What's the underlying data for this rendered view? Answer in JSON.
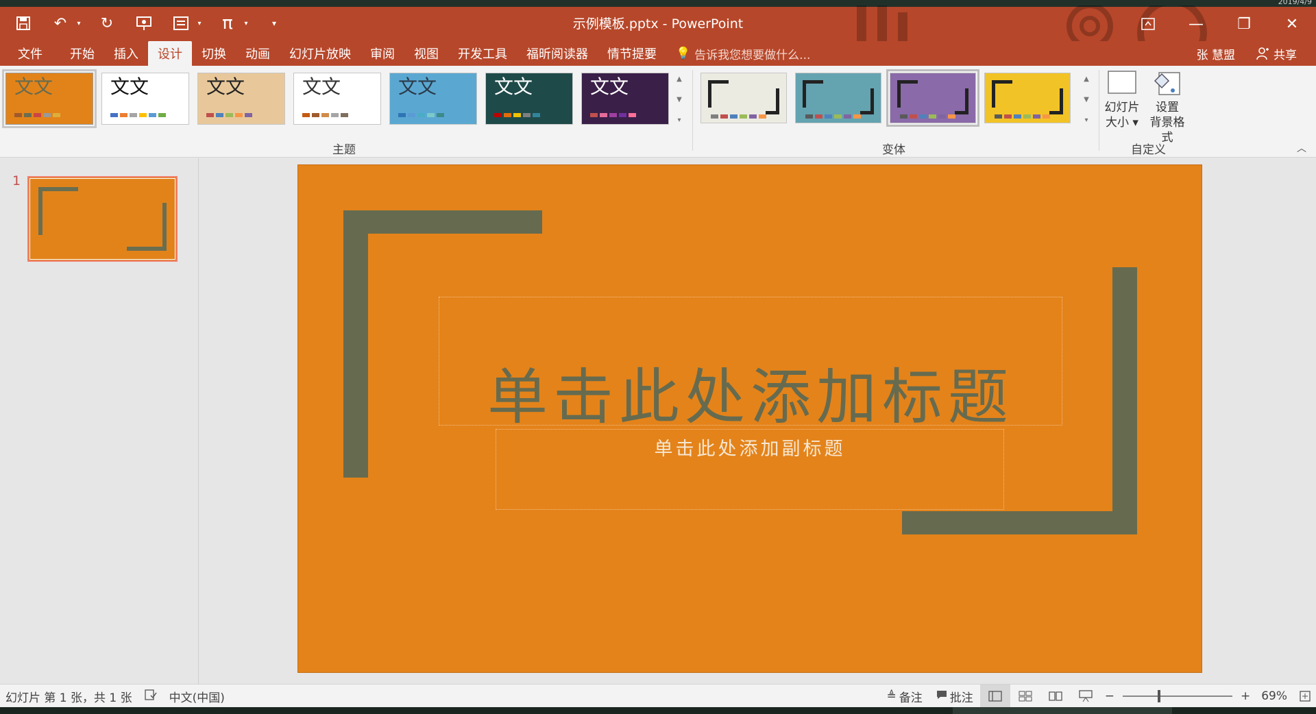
{
  "app": {
    "document_title": "示例模板.pptx - PowerPoint",
    "clock_date": "2019/4/9"
  },
  "menu": {
    "tabs": [
      "文件",
      "开始",
      "插入",
      "设计",
      "切换",
      "动画",
      "幻灯片放映",
      "审阅",
      "视图",
      "开发工具",
      "福昕阅读器",
      "情节提要"
    ],
    "active_tab": "设计",
    "tell_me": "告诉我您想要做什么...",
    "user_name": "张 慧盟",
    "share_label": "共享"
  },
  "ribbon": {
    "themes_group_label": "主题",
    "variants_group_label": "变体",
    "customize_group_label": "自定义",
    "theme_text": "文文",
    "themes": [
      {
        "name": "orange",
        "bg": "#e2831a",
        "fg": "#666b4f",
        "dots": [
          "#a05a2c",
          "#6b6e50",
          "#c44",
          "#999",
          "#dcae3a"
        ]
      },
      {
        "name": "office",
        "bg": "#ffffff",
        "fg": "#111111",
        "dots": [
          "#4472c4",
          "#ed7d31",
          "#a5a5a5",
          "#ffc000",
          "#5b9bd5",
          "#70ad47"
        ]
      },
      {
        "name": "wood",
        "bg": "#e8c89a",
        "fg": "#222222",
        "dots": [
          "#c0504d",
          "#4f81bd",
          "#9bbb59",
          "#f79646",
          "#8064a2"
        ]
      },
      {
        "name": "white-orange",
        "bg": "#ffffff",
        "fg": "#333333",
        "dots": [
          "#c55a11",
          "#a05a2c",
          "#d08b4a",
          "#a5a5a5",
          "#7f6f5f"
        ]
      },
      {
        "name": "blue-pattern",
        "bg": "#5aa8d2",
        "fg": "#2b3a4a",
        "dots": [
          "#2e75b6",
          "#5b9bd5",
          "#4bacc6",
          "#7bc9c9",
          "#3d8a8a"
        ]
      },
      {
        "name": "teal-dark",
        "bg": "#1f4a4a",
        "fg": "#ffffff",
        "dots": [
          "#c00000",
          "#e46c0a",
          "#f2c200",
          "#7f7f7f",
          "#31859c"
        ]
      },
      {
        "name": "purple-dark",
        "bg": "#3a1f48",
        "fg": "#ffffff",
        "dots": [
          "#c0504d",
          "#e36c9a",
          "#9e3fa0",
          "#7030a0",
          "#ff6f9a"
        ]
      }
    ],
    "variants": [
      {
        "name": "beige",
        "bg": "#ecebe2",
        "dots": [
          "#7f7f7f",
          "#c0504d",
          "#4f81bd",
          "#9bbb59",
          "#8064a2",
          "#f79646"
        ]
      },
      {
        "name": "teal",
        "bg": "#64a3b0",
        "dots": [
          "#5a5a5a",
          "#c0504d",
          "#4f81bd",
          "#9bbb59",
          "#8064a2",
          "#f79646"
        ]
      },
      {
        "name": "purple",
        "bg": "#8a6aa8",
        "dots": [
          "#5a5a5a",
          "#c0504d",
          "#4f81bd",
          "#9bbb59",
          "#8064a2",
          "#f79646"
        ]
      },
      {
        "name": "yellow",
        "bg": "#f2c326",
        "dots": [
          "#5a5a5a",
          "#c0504d",
          "#4f81bd",
          "#9bbb59",
          "#8064a2",
          "#f79646"
        ]
      }
    ],
    "slide_size_line1": "幻灯片",
    "slide_size_line2": "大小",
    "format_bg_line1": "设置",
    "format_bg_line2": "背景格式"
  },
  "thumbnail_pane": {
    "slide_number": "1"
  },
  "slide": {
    "bg_color": "#e4831a",
    "accent_color": "#666b4f",
    "title_placeholder": "单击此处添加标题",
    "subtitle_placeholder": "单击此处添加副标题"
  },
  "status": {
    "slide_info": "幻灯片 第 1 张，共 1 张",
    "language": "中文(中国)",
    "notes_label": "备注",
    "comments_label": "批注",
    "zoom_level": "69%",
    "zoom_fraction": 0.33
  }
}
